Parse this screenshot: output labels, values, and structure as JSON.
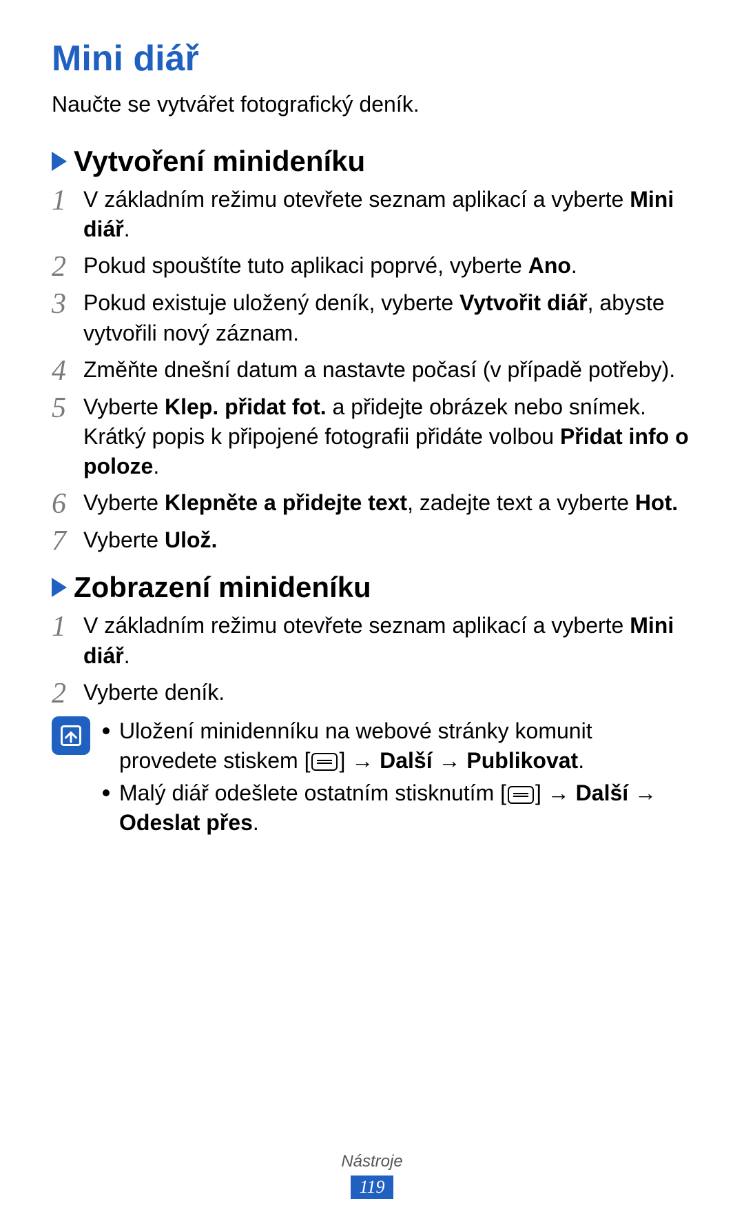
{
  "title": "Mini diář",
  "intro": "Naučte se vytvářet fotografický deník.",
  "sections": {
    "a": {
      "heading": "Vytvoření minideníku",
      "steps": {
        "1_pre": "V základním režimu otevřete seznam aplikací a vyberte ",
        "1_b": "Mini diář",
        "1_post": ".",
        "2_pre": "Pokud spouštíte tuto aplikaci poprvé, vyberte ",
        "2_b": "Ano",
        "2_post": ".",
        "3_pre": "Pokud existuje uložený deník, vyberte ",
        "3_b": "Vytvořit diář",
        "3_post": ", abyste vytvořili nový záznam.",
        "4": "Změňte dnešní datum a nastavte počasí (v případě potřeby).",
        "5a_pre": "Vyberte ",
        "5a_b": "Klep. přidat fot.",
        "5a_post": " a přidejte obrázek nebo snímek.",
        "5b_pre": "Krátký popis k připojené fotografii přidáte volbou ",
        "5b_b": "Přidat info o poloze",
        "5b_post": ".",
        "6_pre": "Vyberte ",
        "6_b": "Klepněte a přidejte text",
        "6_mid": ", zadejte text a vyberte ",
        "6_b2": "Hot.",
        "7_pre": "Vyberte ",
        "7_b": "Ulož."
      }
    },
    "b": {
      "heading": "Zobrazení minideníku",
      "steps": {
        "1_pre": "V základním režimu otevřete seznam aplikací a vyberte ",
        "1_b": "Mini diář",
        "1_post": ".",
        "2": "Vyberte deník."
      },
      "note": {
        "b1_pre": "Uložení minidenníku na webové stránky komunit provedete stiskem [",
        "b1_mid": "] → ",
        "b1_b1": "Další",
        "b1_arrow": " → ",
        "b1_b2": "Publikovat",
        "b1_post": ".",
        "b2_pre": "Malý diář odešlete ostatním stisknutím [",
        "b2_mid": "] → ",
        "b2_b1": "Další",
        "b2_arrow": " → ",
        "b2_b2": "Odeslat přes",
        "b2_post": "."
      }
    }
  },
  "nums": {
    "n1": "1",
    "n2": "2",
    "n3": "3",
    "n4": "4",
    "n5": "5",
    "n6": "6",
    "n7": "7"
  },
  "footer": {
    "label": "Nástroje",
    "page": "119"
  }
}
